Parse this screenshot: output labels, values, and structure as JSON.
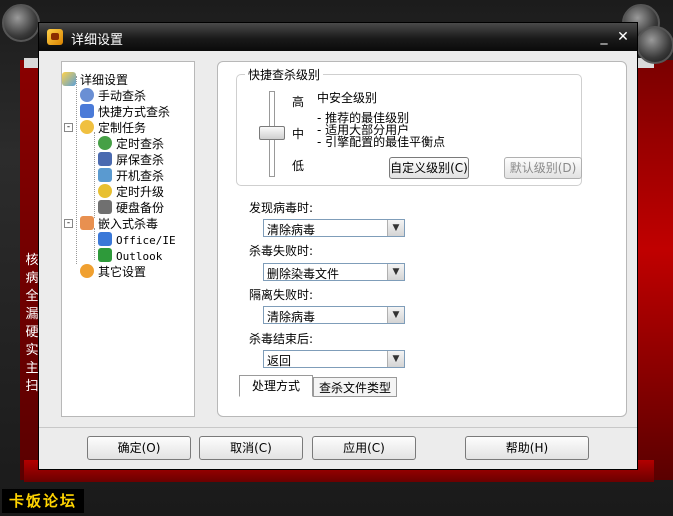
{
  "window": {
    "title": "详细设置"
  },
  "background": {
    "side_chars": [
      "核",
      "病",
      "全",
      "漏",
      "硬",
      "实",
      "主",
      "扫"
    ]
  },
  "tree": {
    "root": "详细设置",
    "items": [
      {
        "label": "手动查杀",
        "icon": "user-scan-icon"
      },
      {
        "label": "快捷方式查杀",
        "icon": "shortcut-icon"
      },
      {
        "label": "定制任务",
        "icon": "clock-task-icon"
      },
      {
        "label": "定时查杀",
        "icon": "timer-icon"
      },
      {
        "label": "屏保查杀",
        "icon": "screensaver-icon"
      },
      {
        "label": "开机查杀",
        "icon": "startup-icon"
      },
      {
        "label": "定时升级",
        "icon": "update-icon"
      },
      {
        "label": "硬盘备份",
        "icon": "disk-backup-icon"
      },
      {
        "label": "嵌入式杀毒",
        "icon": "embed-icon"
      },
      {
        "label": "Office/IE",
        "icon": "office-icon"
      },
      {
        "label": "Outlook",
        "icon": "outlook-icon"
      },
      {
        "label": "其它设置",
        "icon": "settings-icon"
      }
    ]
  },
  "scan_level": {
    "group_title": "快捷查杀级别",
    "high": "高",
    "mid": "中",
    "low": "低",
    "current": "中安全级别",
    "notes": [
      "- 推荐的最佳级别",
      "- 适用大部分用户",
      "- 引擎配置的最佳平衡点"
    ],
    "custom_button": "自定义级别(C)",
    "default_button": "默认级别(D)"
  },
  "actions": {
    "found": {
      "label": "发现病毒时:",
      "value": "清除病毒"
    },
    "fail": {
      "label": "杀毒失败时:",
      "value": "删除染毒文件"
    },
    "isolate_fail": {
      "label": "隔离失败时:",
      "value": "清除病毒"
    },
    "done": {
      "label": "杀毒结束后:",
      "value": "返回"
    }
  },
  "tabs": [
    "处理方式",
    "查杀文件类型"
  ],
  "footer": {
    "ok": "确定(O)",
    "cancel": "取消(C)",
    "apply": "应用(C)",
    "help": "帮助(H)"
  },
  "watermark": "卡饭论坛"
}
